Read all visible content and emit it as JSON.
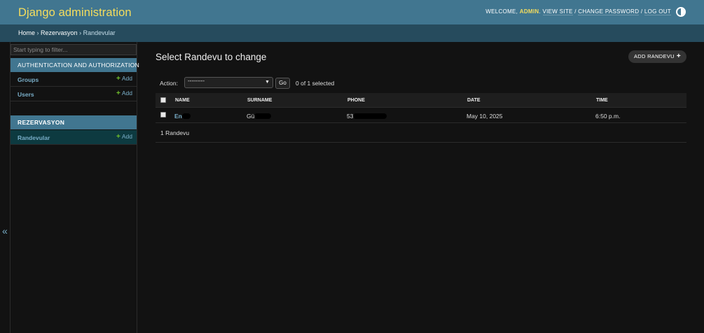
{
  "header": {
    "branding": "Django administration",
    "welcome": "Welcome,",
    "username": "admin",
    "view_site": "View site",
    "change_password": "Change password",
    "log_out": "Log out",
    "separator": "/",
    "theme_icon": "half-circle-contrast-icon"
  },
  "breadcrumbs": {
    "items": [
      "Home",
      "Rezervasyon",
      "Randevular"
    ],
    "separator": "›"
  },
  "sidebar": {
    "filter_placeholder": "Start typing to filter...",
    "collapse_icon": "«",
    "apps": [
      {
        "name": "Authentication and Authorization",
        "models": [
          {
            "label": "Groups",
            "add_label": "Add"
          },
          {
            "label": "Users",
            "add_label": "Add"
          }
        ]
      },
      {
        "name": "Rezervasyon",
        "models": [
          {
            "label": "Randevular",
            "add_label": "Add",
            "current": true
          }
        ]
      }
    ],
    "add_icon": "+"
  },
  "main": {
    "title": "Select Randevu to change",
    "add_button": "Add Randevu",
    "add_icon": "+",
    "actions": {
      "label": "Action:",
      "selected_option": "---------",
      "go_label": "Go",
      "selection_count": "0 of 1 selected"
    },
    "table": {
      "columns": [
        "Name",
        "Surname",
        "Phone",
        "Date",
        "Time"
      ],
      "rows": [
        {
          "name": "En",
          "surname": "Gü",
          "phone": "53",
          "date": "May 10, 2025",
          "time": "6:50 p.m."
        }
      ]
    },
    "result_count": "1 Randevu"
  },
  "colors": {
    "header_bg": "#417690",
    "breadcrumbs_bg": "#264b5d",
    "branding": "#f5dd5d",
    "link": "#79aec8",
    "add_plus": "#70bf2b",
    "page_bg": "#121212"
  }
}
